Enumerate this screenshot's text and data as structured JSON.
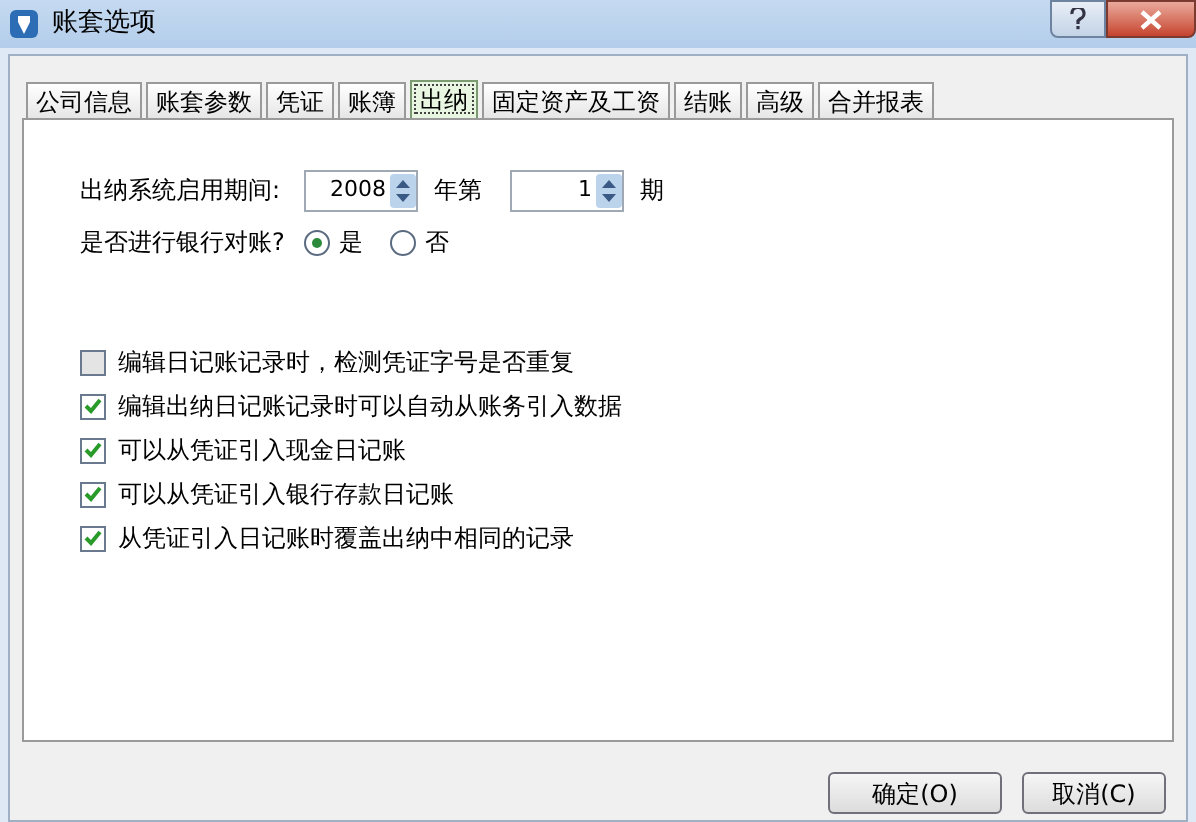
{
  "window": {
    "title": "账套选项"
  },
  "tabs": [
    {
      "label": "公司信息",
      "selected": false
    },
    {
      "label": "账套参数",
      "selected": false
    },
    {
      "label": "凭证",
      "selected": false
    },
    {
      "label": "账簿",
      "selected": false
    },
    {
      "label": "出纳",
      "selected": true
    },
    {
      "label": "固定资产及工资",
      "selected": false
    },
    {
      "label": "结账",
      "selected": false
    },
    {
      "label": "高级",
      "selected": false
    },
    {
      "label": "合并报表",
      "selected": false
    }
  ],
  "period": {
    "label": "出纳系统启用期间:",
    "year": "2008",
    "year_suffix": "年第",
    "period": "1",
    "period_suffix": "期"
  },
  "reconcile": {
    "label": "是否进行银行对账?",
    "options": [
      {
        "label": "是",
        "selected": true
      },
      {
        "label": "否",
        "selected": false
      }
    ]
  },
  "options": [
    {
      "label": "编辑日记账记录时，检测凭证字号是否重复",
      "checked": false
    },
    {
      "label": "编辑出纳日记账记录时可以自动从账务引入数据",
      "checked": true
    },
    {
      "label": "可以从凭证引入现金日记账",
      "checked": true
    },
    {
      "label": "可以从凭证引入银行存款日记账",
      "checked": true
    },
    {
      "label": "从凭证引入日记账时覆盖出纳中相同的记录",
      "checked": true
    }
  ],
  "buttons": [
    "确定(O)",
    "取消(C)"
  ]
}
